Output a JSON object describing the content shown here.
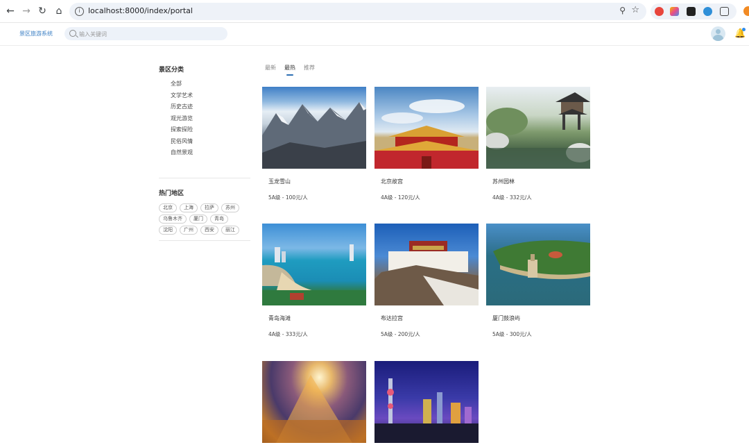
{
  "browser": {
    "url": "localhost:8000/index/portal"
  },
  "header": {
    "brand": "景区旅游系统",
    "search_placeholder": "输入关键词"
  },
  "sidebar": {
    "category_title": "景区分类",
    "categories": [
      "全部",
      "文学艺术",
      "历史古迹",
      "观光游览",
      "探索探险",
      "民俗风情",
      "自然景观"
    ],
    "region_title": "热门地区",
    "regions": [
      "北京",
      "上海",
      "拉萨",
      "苏州",
      "乌鲁木齐",
      "厦门",
      "青岛",
      "沈阳",
      "广州",
      "西安",
      "丽江"
    ]
  },
  "tabs": [
    {
      "label": "最新",
      "active": false
    },
    {
      "label": "最热",
      "active": true
    },
    {
      "label": "推荐",
      "active": false
    }
  ],
  "cards": [
    {
      "name": "玉龙雪山",
      "meta": "5A级 - 100元/人",
      "image": "snow-mountain"
    },
    {
      "name": "北京故宫",
      "meta": "4A级 - 120元/人",
      "image": "forbidden-city"
    },
    {
      "name": "苏州园林",
      "meta": "4A级 - 332元/人",
      "image": "suzhou-garden"
    },
    {
      "name": "青岛海滩",
      "meta": "4A级 - 333元/人",
      "image": "qingdao-beach"
    },
    {
      "name": "布达拉宫",
      "meta": "5A级 - 200元/人",
      "image": "potala-palace"
    },
    {
      "name": "厦门鼓浪屿",
      "meta": "5A级 - 300元/人",
      "image": "gulangyu-island"
    },
    {
      "name": "",
      "meta": "",
      "image": "city-night-lights"
    },
    {
      "name": "",
      "meta": "",
      "image": "shanghai-skyline"
    }
  ]
}
